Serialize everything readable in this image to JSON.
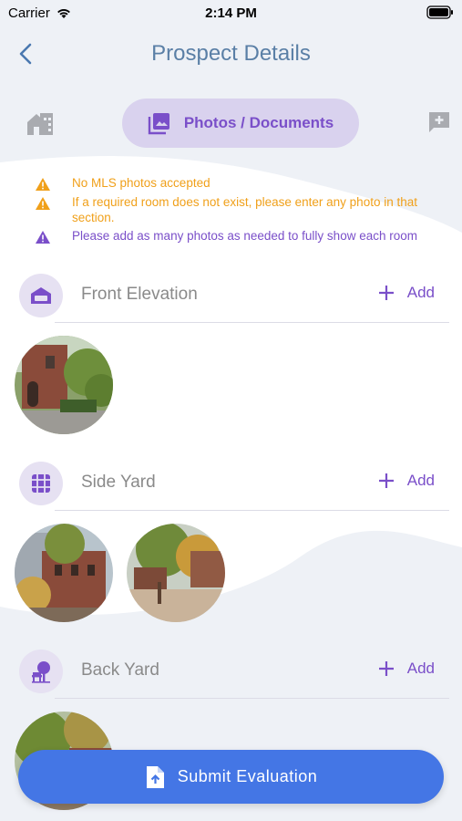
{
  "status_bar": {
    "carrier": "Carrier",
    "time": "2:14 PM"
  },
  "header": {
    "title": "Prospect Details"
  },
  "tabs": {
    "active_label": "Photos / Documents"
  },
  "notices": [
    {
      "text": "No MLS photos accepted",
      "color": "#f0a01a"
    },
    {
      "text": "If a required room does not exist, please enter any photo in that section.",
      "color": "#f0a01a"
    },
    {
      "text": "Please add as many photos as needed to fully show each room",
      "color": "#7a4fc9"
    }
  ],
  "sections": [
    {
      "title": "Front Elevation",
      "add_label": "Add",
      "icon": "house-front-icon",
      "photo_count": 1
    },
    {
      "title": "Side Yard",
      "add_label": "Add",
      "icon": "fence-icon",
      "photo_count": 2
    },
    {
      "title": "Back Yard",
      "add_label": "Add",
      "icon": "backyard-tree-icon",
      "photo_count": 1
    }
  ],
  "submit": {
    "label": "Submit Evaluation"
  },
  "colors": {
    "accent": "#7a4fc9",
    "primary_button": "#4476e5",
    "title": "#5a7fa6",
    "warning": "#f0a01a"
  }
}
